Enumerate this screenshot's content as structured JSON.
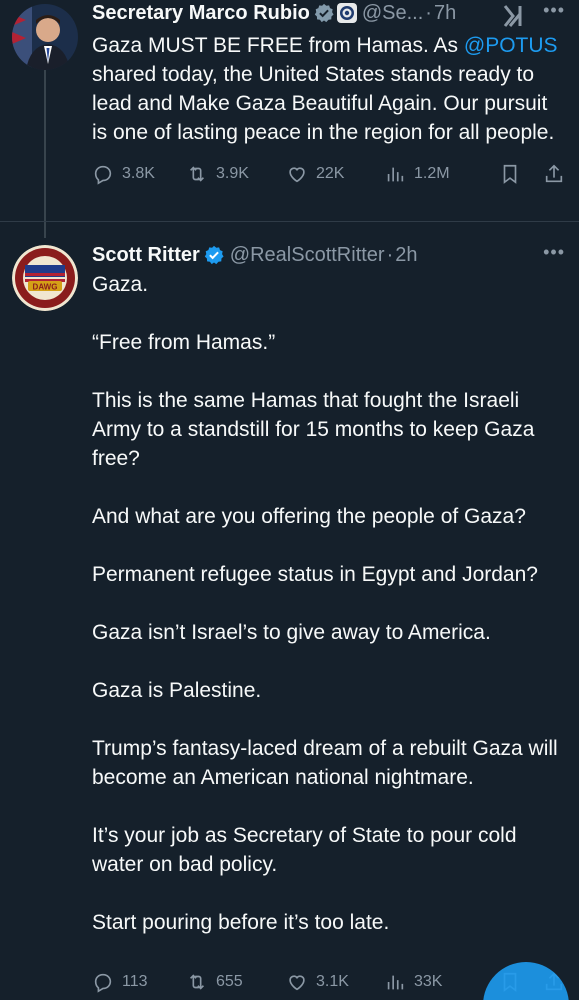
{
  "tweet1": {
    "name": "Secretary Marco Rubio",
    "handle": "@Se...",
    "time": "7h",
    "text_before": "Gaza MUST BE FREE from Hamas. As ",
    "mention": "@POTUS",
    "text_after": " shared today, the United States stands ready to lead and Make Gaza Beautiful Again. Our pursuit is one of lasting peace in the region for all people.",
    "replies": "3.8K",
    "reposts": "3.9K",
    "likes": "22K",
    "views": "1.2M"
  },
  "tweet2": {
    "name": "Scott Ritter",
    "handle": "@RealScottRitter",
    "time": "2h",
    "avatar_text": "DAWG",
    "paragraphs": [
      "Gaza.",
      "“Free from Hamas.”",
      "This is the same Hamas that fought the Israeli Army to a standstill for 15 months to keep Gaza free?",
      "And what are you offering the people of Gaza?",
      "Permanent refugee status in Egypt and Jordan?",
      "Gaza isn’t Israel’s to give away to America.",
      "Gaza is Palestine.",
      "Trump’s fantasy-laced dream of a rebuilt Gaza will become an American national nightmare.",
      "It’s your job as Secretary of State to pour cold water on bad policy.",
      "Start pouring before it’s too late."
    ],
    "replies": "113",
    "reposts": "655",
    "likes": "3.1K",
    "views": "33K"
  },
  "icons": {
    "reply": "reply-icon",
    "repost": "repost-icon",
    "like": "like-icon",
    "views": "views-icon",
    "bookmark": "bookmark-icon",
    "share": "share-icon",
    "more": "more-icon",
    "verified": "verified-icon",
    "org": "org-badge-icon",
    "grok": "grok-icon"
  },
  "colors": {
    "background": "#15202b",
    "text": "#f7f9f9",
    "muted": "#8b98a5",
    "accent": "#1d9bf0"
  }
}
